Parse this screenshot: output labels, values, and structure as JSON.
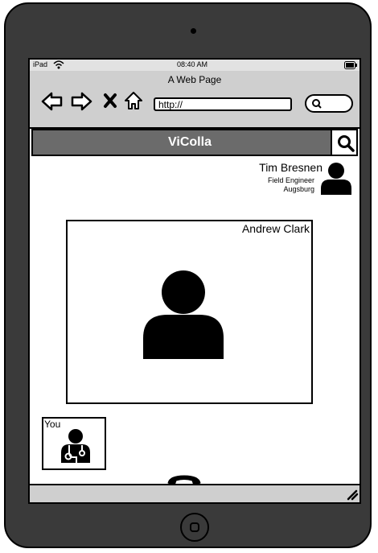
{
  "status": {
    "device": "iPad",
    "time": "08:40 AM"
  },
  "browser": {
    "title": "A Web Page",
    "url": "http://"
  },
  "app": {
    "title": "ViColla"
  },
  "caller": {
    "name": "Tim Bresnen",
    "role": "Field Engineer",
    "location": "Augsburg"
  },
  "remote": {
    "name": "Andrew Clark"
  },
  "self": {
    "label": "You"
  },
  "icons": {
    "back": "back-arrow-icon",
    "forward": "forward-arrow-icon",
    "stop": "close-icon",
    "home": "home-icon",
    "search": "search-icon",
    "wifi": "wifi-icon",
    "battery": "battery-icon",
    "avatar": "user-icon",
    "doctor": "doctor-icon",
    "hangup": "phone-hangup-icon",
    "resize": "resize-grip-icon"
  }
}
